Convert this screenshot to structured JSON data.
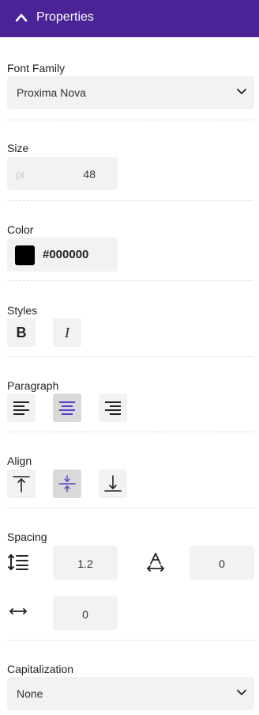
{
  "header": {
    "title": "Properties"
  },
  "font_family": {
    "label": "Font Family",
    "value": "Proxima Nova"
  },
  "size": {
    "label": "Size",
    "unit": "pt",
    "value": "48"
  },
  "color": {
    "label": "Color",
    "hex": "#000000",
    "swatch": "#000000"
  },
  "styles": {
    "label": "Styles",
    "bold": "B",
    "italic": "I"
  },
  "paragraph": {
    "label": "Paragraph",
    "active": "center"
  },
  "align": {
    "label": "Align",
    "active": "middle"
  },
  "spacing": {
    "label": "Spacing",
    "line_height": "1.2",
    "letter_spacing": "0",
    "word_spacing": "0"
  },
  "capitalization": {
    "label": "Capitalization",
    "value": "None"
  },
  "colors": {
    "header": "#4a2496",
    "accent": "#5a3dc8"
  }
}
